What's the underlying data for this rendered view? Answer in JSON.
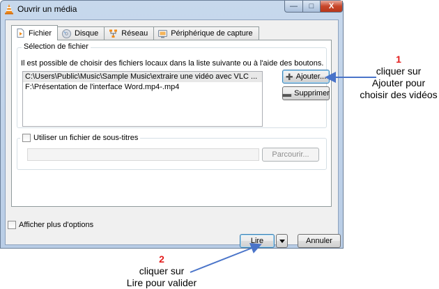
{
  "window": {
    "title": "Ouvrir un média",
    "controls": {
      "minimize": "—",
      "maximize": "□",
      "close": "X"
    }
  },
  "tabs": [
    {
      "label": "Fichier",
      "icon": "file-icon",
      "active": true
    },
    {
      "label": "Disque",
      "icon": "disc-icon",
      "active": false
    },
    {
      "label": "Réseau",
      "icon": "network-icon",
      "active": false
    },
    {
      "label": "Périphérique de capture",
      "icon": "capture-device-icon",
      "active": false
    }
  ],
  "file_selection": {
    "title": "Sélection de fichier",
    "hint": "Il est possible de choisir des fichiers locaux dans la liste suivante ou à l'aide des boutons.",
    "files": [
      "C:\\Users\\Public\\Music\\Sample Music\\extraire une vidéo avec  VLC ...",
      "F:\\Présentation de l'interface Word.mp4-.mp4"
    ],
    "add_button": "Ajouter...",
    "remove_button": "Supprimer"
  },
  "subtitles": {
    "checkbox_label": "Utiliser un fichier de sous-titres",
    "checked": false,
    "field_value": "",
    "browse_button": "Parcourir..."
  },
  "more_options": {
    "label": "Afficher plus d'options",
    "checked": false
  },
  "footer": {
    "play_button": "Lire",
    "cancel_button": "Annuler"
  },
  "annotations": {
    "step1": {
      "number": "1",
      "line1": "cliquer sur",
      "line2": "Ajouter pour",
      "line3": "choisir des vidéos"
    },
    "step2": {
      "number": "2",
      "line1": "cliquer sur",
      "line2": "Lire pour valider"
    }
  },
  "colors": {
    "annotation_number": "#e31b1b",
    "arrow": "#4a74c9",
    "title_bar": "#c7d8ec",
    "close_button": "#c7462a"
  }
}
